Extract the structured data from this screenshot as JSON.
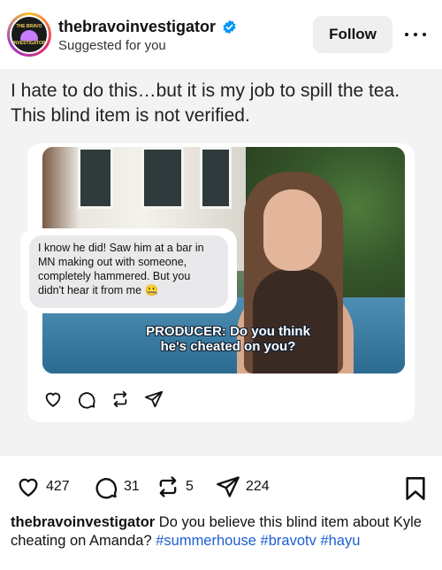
{
  "header": {
    "username": "thebravoinvestigator",
    "subtitle": "Suggested for you",
    "follow_label": "Follow",
    "avatar_text_1": "THE BRAVO",
    "avatar_text_2": "INVESTIGATOR",
    "verified_color": "#0095f6"
  },
  "post": {
    "title": "I hate to do this…but it is my job to spill the tea. This blind item is not verified.",
    "chat_message": "I know he did! Saw him at a bar in MN making out with someone, completely hammered. But you didn't hear it from me 🤐",
    "video_caption_1": "PRODUCER: Do you think",
    "video_caption_2": "he's cheated on you?"
  },
  "actions": {
    "likes": "427",
    "comments": "31",
    "reposts": "5",
    "shares": "224"
  },
  "caption": {
    "username": "thebravoinvestigator",
    "text": " Do you believe this blind item about Kyle cheating on Amanda? ",
    "tag1": "#summerhouse",
    "tag2": "#bravotv",
    "tag3": "#hayu"
  },
  "colors": {
    "link": "#1c5fd4",
    "post_bg": "#f3f3f3"
  }
}
